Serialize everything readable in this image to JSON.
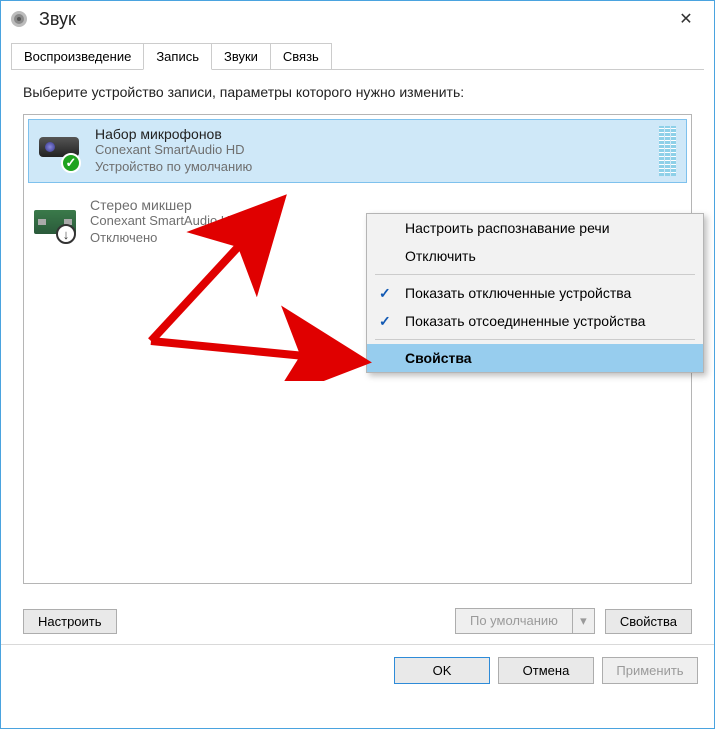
{
  "window": {
    "title": "Звук"
  },
  "tabs": [
    {
      "label": "Воспроизведение"
    },
    {
      "label": "Запись"
    },
    {
      "label": "Звуки"
    },
    {
      "label": "Связь"
    }
  ],
  "active_tab_index": 1,
  "instruction": "Выберите устройство записи, параметры которого нужно изменить:",
  "devices": [
    {
      "name": "Набор микрофонов",
      "driver": "Conexant SmartAudio HD",
      "status": "Устройство по умолчанию",
      "selected": true,
      "enabled": true,
      "icon": "webcam-icon",
      "badge": "check"
    },
    {
      "name": "Стерео микшер",
      "driver": "Conexant SmartAudio HD",
      "status": "Отключено",
      "selected": false,
      "enabled": false,
      "icon": "soundcard-icon",
      "badge": "down"
    }
  ],
  "context_menu": {
    "items": [
      {
        "label": "Настроить распознавание речи",
        "checked": false,
        "highlight": false
      },
      {
        "label": "Отключить",
        "checked": false,
        "highlight": false
      }
    ],
    "items2": [
      {
        "label": "Показать отключенные устройства",
        "checked": true,
        "highlight": false
      },
      {
        "label": "Показать отсоединенные устройства",
        "checked": true,
        "highlight": false
      }
    ],
    "items3": [
      {
        "label": "Свойства",
        "checked": false,
        "highlight": true
      }
    ]
  },
  "bottom": {
    "configure": "Настроить",
    "set_default": "По умолчанию",
    "properties": "Свойства"
  },
  "dialog_buttons": {
    "ok": "OK",
    "cancel": "Отмена",
    "apply": "Применить"
  }
}
